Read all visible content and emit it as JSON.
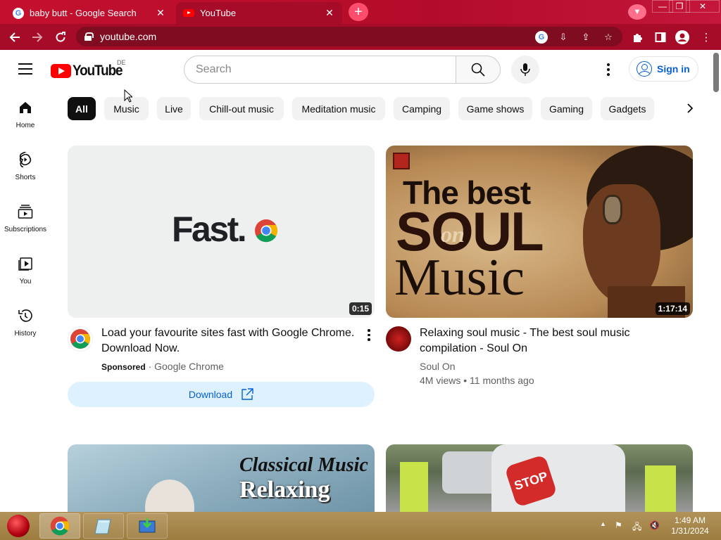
{
  "browser": {
    "tabs": [
      {
        "title": "baby butt - Google Search",
        "favicon": "google-icon"
      },
      {
        "title": "YouTube",
        "favicon": "youtube-icon",
        "active": true
      }
    ],
    "url": "youtube.com",
    "accent": "#a60b27"
  },
  "youtube": {
    "logo_text": "YouTube",
    "region": "DE",
    "search_placeholder": "Search",
    "sign_in": "Sign in"
  },
  "leftnav": [
    {
      "label": "Home",
      "icon": "home-icon"
    },
    {
      "label": "Shorts",
      "icon": "shorts-icon"
    },
    {
      "label": "Subscriptions",
      "icon": "subscriptions-icon"
    },
    {
      "label": "You",
      "icon": "you-icon"
    },
    {
      "label": "History",
      "icon": "history-icon"
    }
  ],
  "chips": [
    "All",
    "Music",
    "Live",
    "Chill-out music",
    "Meditation music",
    "Camping",
    "Game shows",
    "Gaming",
    "Gadgets"
  ],
  "videos": [
    {
      "thumb_text": "Fast.",
      "duration": "0:15",
      "title_line1": "Load your favourite sites fast with Google Chrome.",
      "title_line2": "Download Now.",
      "sponsored": "Sponsored",
      "channel": "Google Chrome",
      "cta": "Download"
    },
    {
      "thumb_line1": "The best",
      "thumb_line2": "SOUL",
      "thumb_on": "on",
      "thumb_line3": "Music",
      "duration": "1:17:14",
      "title_line1": "Relaxing soul music - The best soul music",
      "title_line2": "compilation - Soul On",
      "channel": "Soul On",
      "views": "4M views",
      "age": "11 months ago"
    },
    {
      "thumb_line1": "Classical Music",
      "thumb_line2": "Relaxing"
    },
    {
      "thumb_sign": "STOP"
    }
  ],
  "taskbar": {
    "time": "1:49 AM",
    "date": "1/31/2024"
  }
}
